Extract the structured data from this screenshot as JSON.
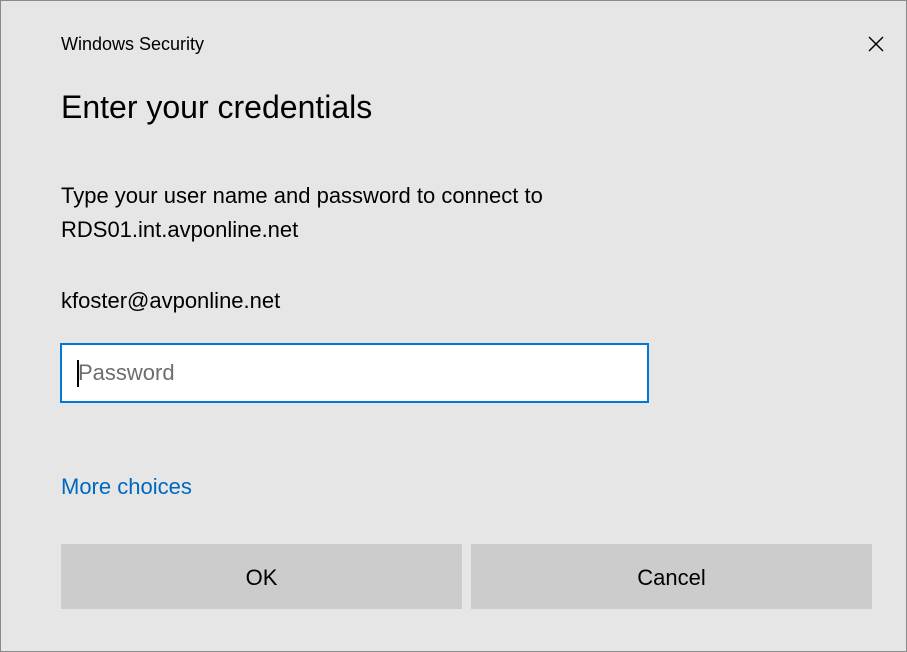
{
  "window": {
    "title": "Windows Security",
    "close_icon": "close-icon"
  },
  "dialog": {
    "heading": "Enter your credentials",
    "message_line1": "Type your user name and password to connect to",
    "message_line2": "RDS01.int.avponline.net",
    "username": "kfoster@avponline.net",
    "password": {
      "value": "",
      "placeholder": "Password"
    },
    "more_choices_label": "More choices"
  },
  "buttons": {
    "ok_label": "OK",
    "cancel_label": "Cancel"
  },
  "colors": {
    "background": "#e6e6e6",
    "accent": "#0078d7",
    "link": "#0067c0",
    "button": "#cccccc"
  }
}
